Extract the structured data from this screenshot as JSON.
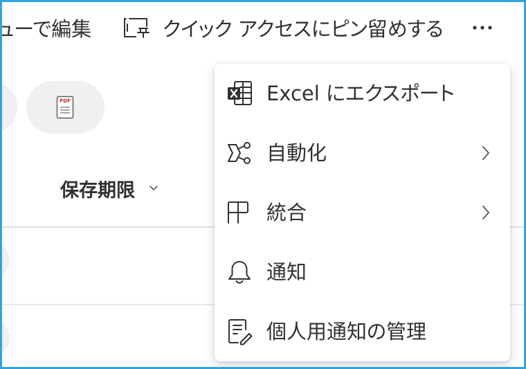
{
  "toolbar": {
    "edit_label": "ューで編集",
    "pin_label": "クイック アクセスにピン留めする",
    "pin_icon": "pin-to-quick-access-icon",
    "more_icon": "more-icon"
  },
  "file_type_button": {
    "icon": "pdf-file-icon",
    "icon_text": "PDF"
  },
  "column_header": {
    "label": "保存期限",
    "icon": "chevron-down-icon"
  },
  "menu": {
    "items": [
      {
        "label": "Excel にエクスポート",
        "icon": "excel-icon",
        "has_submenu": false
      },
      {
        "label": "自動化",
        "icon": "automate-icon",
        "has_submenu": true
      },
      {
        "label": "統合",
        "icon": "integrate-icon",
        "has_submenu": true
      },
      {
        "label": "通知",
        "icon": "bell-icon",
        "has_submenu": false
      },
      {
        "label": "個人用通知の管理",
        "icon": "manage-alerts-icon",
        "has_submenu": false
      }
    ]
  },
  "colors": {
    "frame": "#2fa4dd",
    "text": "#323130",
    "pill_background": "#f0f0f0",
    "divider": "#e1dfdd",
    "chevron": "#605e5c",
    "pdf_red": "#c4262e"
  }
}
